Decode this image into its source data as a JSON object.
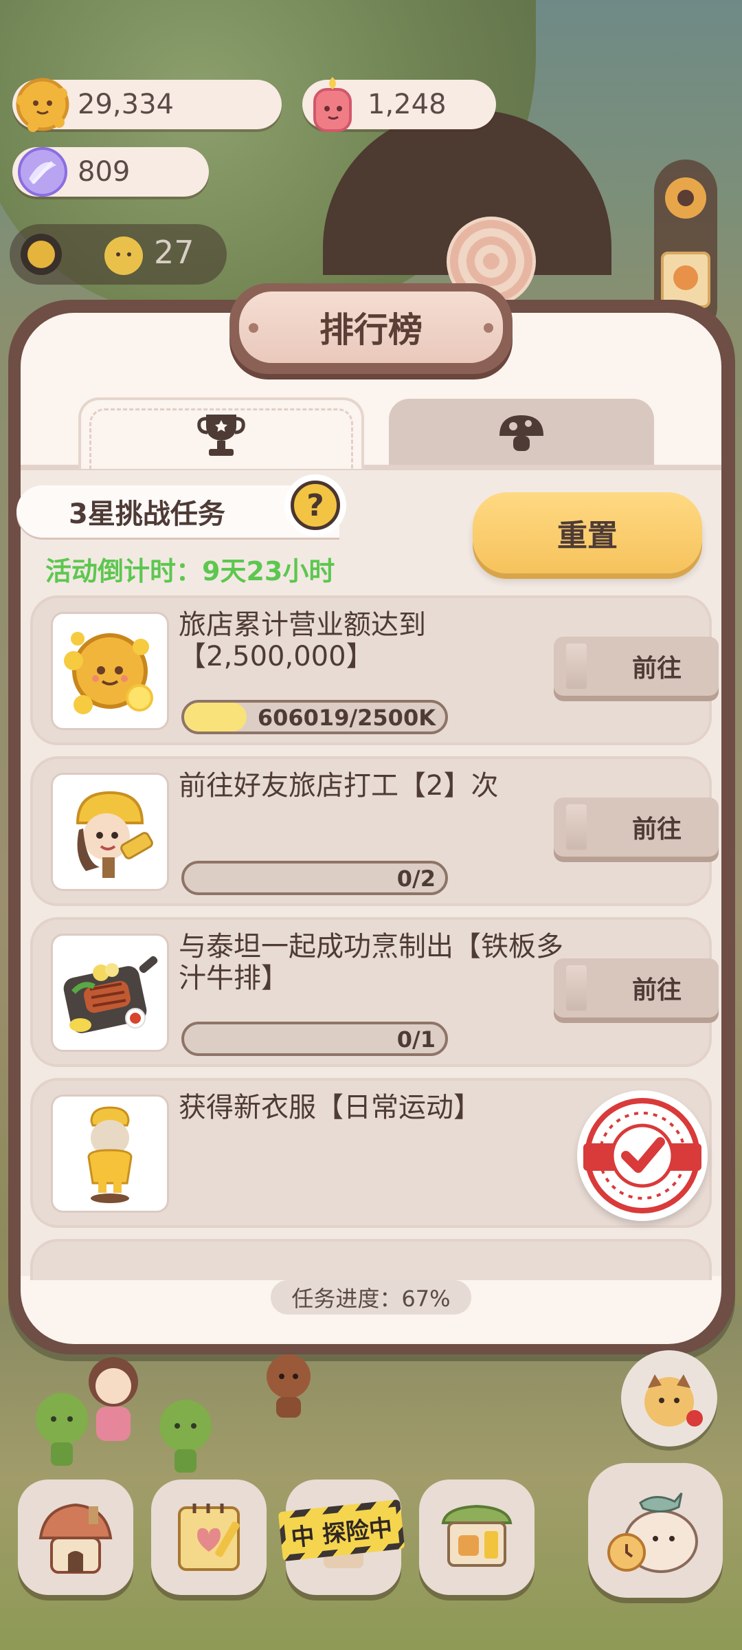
{
  "resources": {
    "coins": "29,334",
    "candles": "1,248",
    "crystals": "809"
  },
  "level": "27",
  "panel": {
    "title": "排行榜",
    "tabs": [
      {
        "icon": "trophy-icon",
        "active": true
      },
      {
        "icon": "mushroom-icon",
        "active": false
      }
    ],
    "challenge_label": "3星挑战任务",
    "help_symbol": "?",
    "countdown": "活动倒计时：9天23小时",
    "reset_label": "重置",
    "tasks": [
      {
        "desc": "旅店累计营业额达到【2,500,000】",
        "progress_text": "606019/2500K",
        "progress": 0.24,
        "button": "前往",
        "icon": "cookie-coin-icon"
      },
      {
        "desc": "前往好友旅店打工【2】次",
        "progress_text": "0/2",
        "progress": 0,
        "button": "前往",
        "icon": "worker-girl-icon"
      },
      {
        "desc": "与泰坦一起成功烹制出【铁板多汁牛排】",
        "progress_text": "0/1",
        "progress": 0,
        "button": "前往",
        "icon": "steak-plate-icon"
      },
      {
        "desc": "获得新衣服【日常运动】",
        "completed": true,
        "icon": "yellow-outfit-icon"
      }
    ],
    "footer_progress": "任务进度：67%"
  },
  "bottom_nav": {
    "explore_label": "中 探险中",
    "items": [
      "house-icon",
      "notebook-icon",
      "explore-icon",
      "shop-icon",
      "fish-character-icon"
    ]
  },
  "colors": {
    "accent_yellow": "#f6c35c",
    "countdown_green": "#5cc74f",
    "panel_border": "#6e4e45",
    "stamp_red": "#d93a3a"
  }
}
